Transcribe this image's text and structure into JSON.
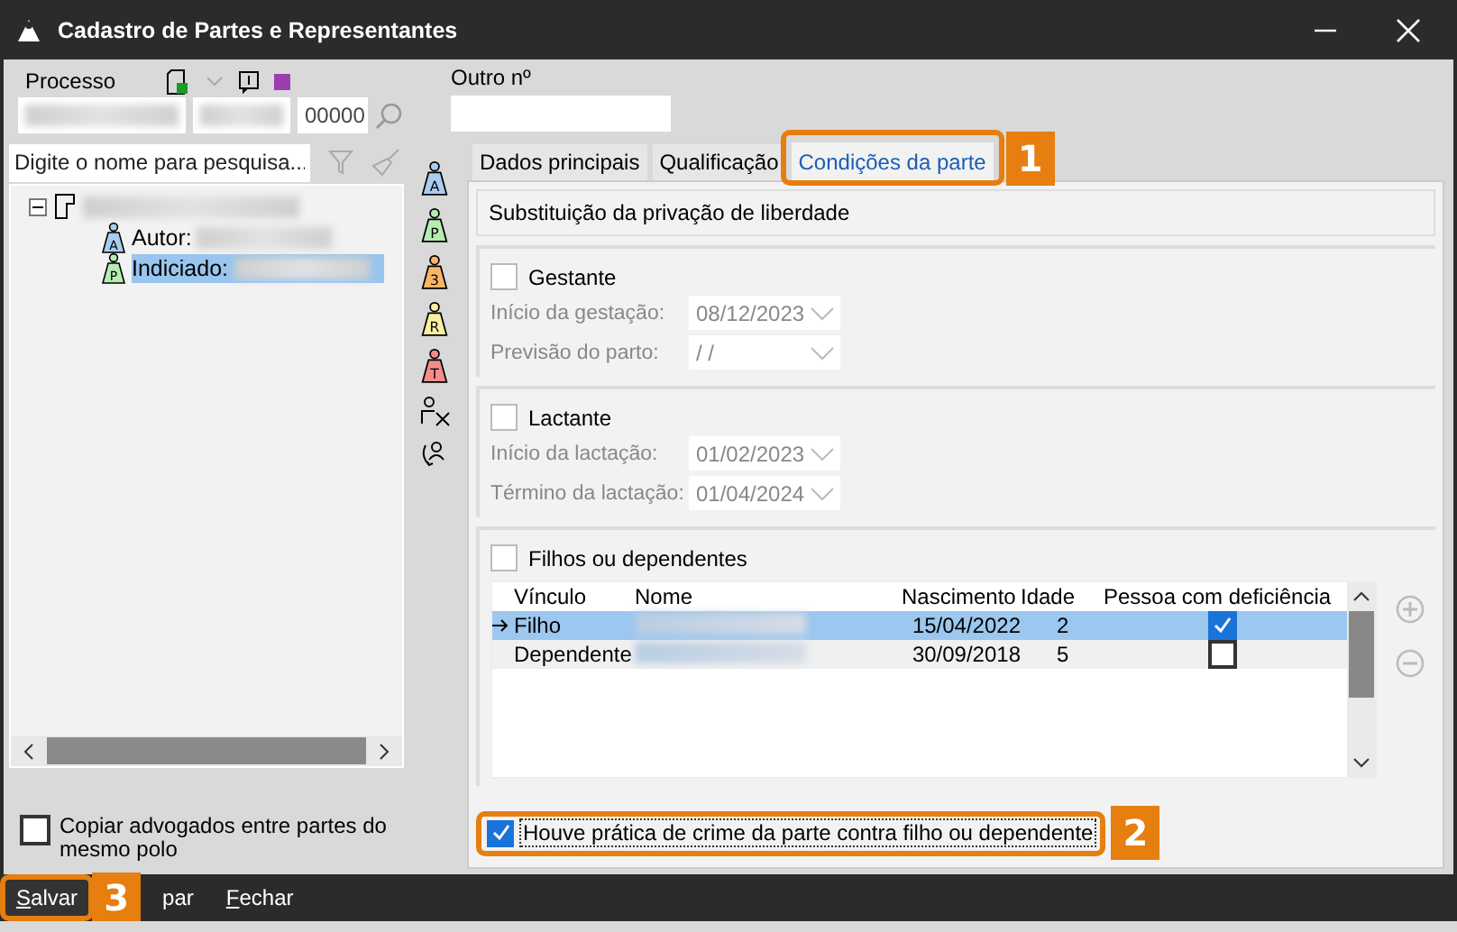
{
  "window": {
    "title": "Cadastro de Partes e Representantes"
  },
  "processo": {
    "label": "Processo",
    "number_suffix": "00000",
    "outro_label": "Outro nº"
  },
  "search": {
    "placeholder": "Digite o nome para pesquisa..."
  },
  "tree": [
    {
      "expanded": true,
      "children": [
        {
          "label": "Autor:",
          "color": "#a9cdf0",
          "letter": "A",
          "selected": false
        },
        {
          "label": "Indiciado:",
          "color": "#b6ebb1",
          "letter": "P",
          "selected": true
        }
      ]
    }
  ],
  "side_tools": [
    {
      "kind": "party",
      "letter": "A",
      "color": "#a9cdf0"
    },
    {
      "kind": "party",
      "letter": "P",
      "color": "#b6ebb1"
    },
    {
      "kind": "party",
      "letter": "3",
      "color": "#f7b567"
    },
    {
      "kind": "party",
      "letter": "R",
      "color": "#f8f0a0"
    },
    {
      "kind": "party",
      "letter": "T",
      "color": "#f48c8c"
    },
    {
      "kind": "remove"
    },
    {
      "kind": "swap"
    }
  ],
  "tabs": [
    {
      "label": "Dados principais",
      "selected": false
    },
    {
      "label": "Qualificação",
      "selected": false
    },
    {
      "label": "Condições da parte",
      "selected": true,
      "callout": "1"
    }
  ],
  "section_title": "Substituição da privação de liberdade",
  "groups": [
    {
      "label": "Gestante",
      "checked": false,
      "fields": [
        {
          "label": "Início da gestação:",
          "value": "08/12/2023"
        },
        {
          "label": "Previsão do parto:",
          "value": "/ /"
        }
      ]
    },
    {
      "label": "Lactante",
      "checked": false,
      "fields": [
        {
          "label": "Início da lactação:",
          "value": "01/02/2023"
        },
        {
          "label": "Término da lactação:",
          "value": "01/04/2024"
        }
      ]
    }
  ],
  "dependents": {
    "label": "Filhos ou dependentes",
    "checked": false,
    "columns": [
      "Vínculo",
      "Nome",
      "Nascimento",
      "Idade",
      "Pessoa com deficiência"
    ],
    "rows": [
      {
        "vinculo": "Filho",
        "nascimento": "15/04/2022",
        "idade": "2",
        "deficiencia": true,
        "selected": true
      },
      {
        "vinculo": "Dependente",
        "nascimento": "30/09/2018",
        "idade": "5",
        "deficiencia": false,
        "selected": false
      }
    ]
  },
  "crime_checkbox": {
    "label": "Houve prática de crime da parte contra filho ou dependente",
    "checked": true,
    "callout": "2"
  },
  "copy_checkbox": {
    "label": "Copiar advogados entre partes do mesmo polo",
    "checked": false
  },
  "buttons": [
    {
      "label": "Salvar",
      "mnemonic": true,
      "callout": "3"
    },
    {
      "label": "par",
      "mnemonic": false
    },
    {
      "label": "Fechar",
      "mnemonic": true
    }
  ]
}
